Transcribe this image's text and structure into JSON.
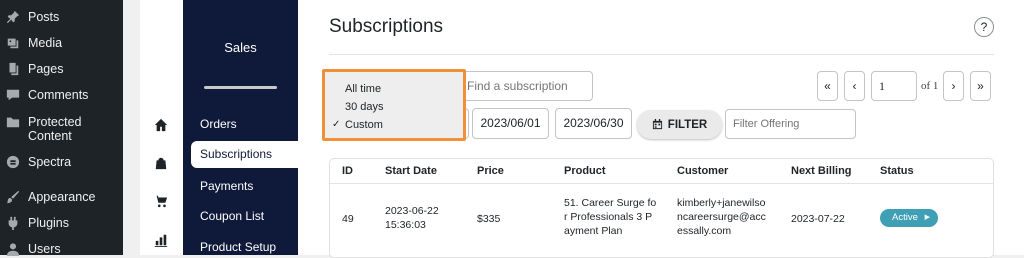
{
  "wp_menu": [
    {
      "label": "Posts",
      "icon": "pin-icon"
    },
    {
      "label": "Media",
      "icon": "media-icon"
    },
    {
      "label": "Pages",
      "icon": "pages-icon"
    },
    {
      "label": "Comments",
      "icon": "comments-icon"
    },
    {
      "label": "Protected Content",
      "icon": "folder-icon"
    },
    {
      "label": "Spectra",
      "icon": "spectra-icon"
    },
    {
      "label": "Appearance",
      "icon": "brush-icon"
    },
    {
      "label": "Plugins",
      "icon": "plugin-icon"
    },
    {
      "label": "Users",
      "icon": "user-icon"
    }
  ],
  "sales_nav": {
    "title": "Sales",
    "items": [
      "Orders",
      "Subscriptions",
      "Payments",
      "Coupon List",
      "Product Setup"
    ],
    "active": "Subscriptions"
  },
  "page": {
    "title": "Subscriptions",
    "help": "?"
  },
  "search": {
    "placeholder": "Find a subscription"
  },
  "pagination": {
    "first": "«",
    "prev": "‹",
    "next": "›",
    "last": "»",
    "page_value": "1",
    "of_label": "of 1"
  },
  "filters": {
    "date_from": "2023/06/01",
    "date_to": "2023/06/30",
    "filter_button": "FILTER",
    "offering_placeholder": "Filter Offering"
  },
  "range_dropdown": {
    "options": [
      "All time",
      "30 days",
      "Custom"
    ],
    "selected": "Custom",
    "check": "✓"
  },
  "table": {
    "headers": [
      "ID",
      "Start Date",
      "Price",
      "Product",
      "Customer",
      "Next Billing",
      "Status"
    ],
    "rows": [
      {
        "id": "49",
        "start_date_1": "2023-06-22",
        "start_date_2": "15:36:03",
        "price": "$335",
        "product_1": "51. Career Surge fo",
        "product_2": "r Professionals 3 P",
        "product_3": "ayment Plan",
        "customer_1": "kimberly+janewilso",
        "customer_2": "ncareersurge@acc",
        "customer_3": "essally.com",
        "next_billing": "2023-07-22",
        "status": "Active",
        "status_arrow": "▶"
      }
    ]
  },
  "colors": {
    "accent": "#f0913a",
    "sales_nav_bg": "#0f1a3a",
    "status_active": "#3f9fb5",
    "wp_sidebar": "#1d2327"
  }
}
